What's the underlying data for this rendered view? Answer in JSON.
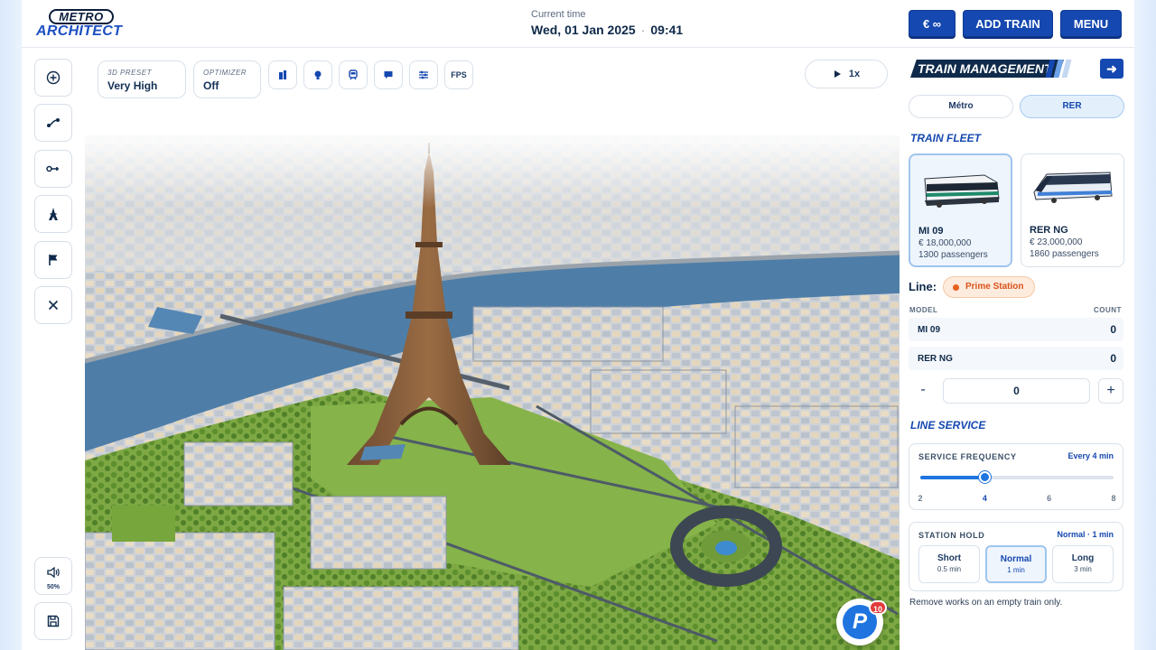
{
  "header": {
    "logo_top": "METRO",
    "logo_bottom": "ARCHITECT",
    "time_caption": "Current time",
    "date": "Wed, 01 Jan 2025",
    "clock": "09:41",
    "money_label": "€ ∞",
    "add_train_label": "ADD TRAIN",
    "menu_label": "MENU"
  },
  "toolbar_left": {
    "volume_percent": "50%"
  },
  "top_controls": {
    "preset_caption": "3D PRESET",
    "preset_value": "Very High",
    "optimizer_caption": "OPTIMIZER",
    "optimizer_value": "Off",
    "fps_label": "FPS",
    "speed_label": "1x"
  },
  "panel": {
    "title": "TRAIN MANAGEMENT",
    "tabs": [
      "Métro",
      "RER"
    ],
    "active_tab": "RER",
    "fleet_title": "TRAIN FLEET",
    "fleet": [
      {
        "name": "MI 09",
        "price": "€ 18,000,000",
        "passengers": "1300 passengers",
        "selected": true
      },
      {
        "name": "RER NG",
        "price": "€ 23,000,000",
        "passengers": "1860 passengers",
        "selected": false
      }
    ],
    "line_label": "Line:",
    "line_name": "Prime Station",
    "line_color": "#e8601e",
    "table_head_model": "MODEL",
    "table_head_count": "COUNT",
    "rows": [
      {
        "model": "MI 09",
        "count": "0"
      },
      {
        "model": "RER NG",
        "count": "0"
      }
    ],
    "stepper_minus": "-",
    "stepper_value": "0",
    "stepper_plus": "+",
    "service_title": "LINE SERVICE",
    "frequency_caption": "SERVICE FREQUENCY",
    "frequency_value": "Every 4 min",
    "frequency_ticks": [
      "2",
      "4",
      "6",
      "8"
    ],
    "frequency_selected": 4,
    "frequency_min": 2,
    "frequency_max": 8,
    "hold_caption": "STATION HOLD",
    "hold_value": "Normal · 1 min",
    "hold_options": [
      {
        "name": "Short",
        "sub": "0.5 min"
      },
      {
        "name": "Normal",
        "sub": "1 min"
      },
      {
        "name": "Long",
        "sub": "3 min"
      }
    ],
    "hold_selected": "Normal",
    "note": "Remove works on an empty train only."
  },
  "notification": {
    "icon_letter": "P",
    "count": "10"
  },
  "colors": {
    "brand_blue": "#1548b0",
    "accent_blue": "#1f74e0",
    "dark_navy": "#0f2a4a"
  }
}
